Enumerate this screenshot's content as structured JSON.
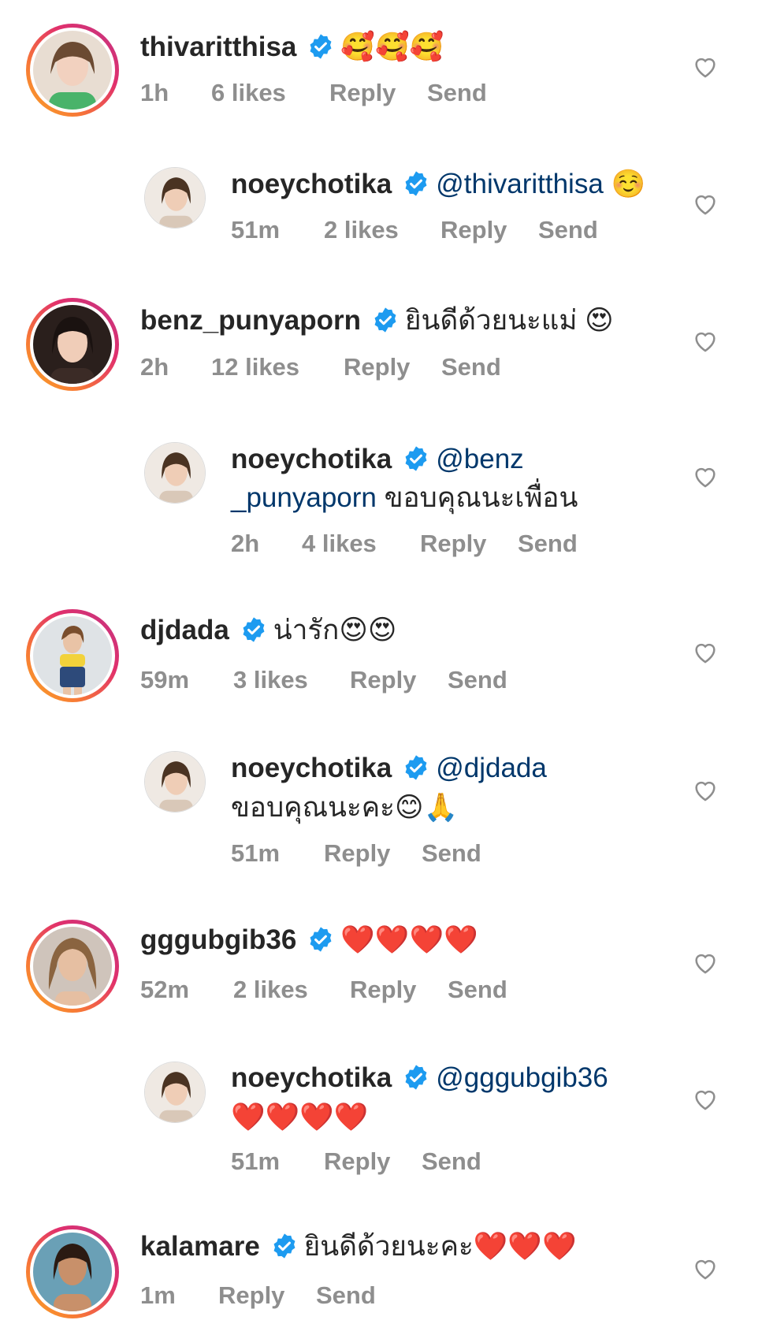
{
  "comments": [
    {
      "username": "thivaritthisa",
      "text": "",
      "emoji": "🥰🥰🥰",
      "time": "1h",
      "likes": "6 likes",
      "reply": "Reply",
      "send": "Send"
    },
    {
      "username": "noeychotika",
      "mention": "@thivaritthisa",
      "text": "",
      "emoji": "☺️",
      "time": "51m",
      "likes": "2 likes",
      "reply": "Reply",
      "send": "Send"
    },
    {
      "username": "benz_punyaporn",
      "text": "ยินดีด้วยนะแม่ ",
      "emoji": "😍",
      "time": "2h",
      "likes": "12 likes",
      "reply": "Reply",
      "send": "Send"
    },
    {
      "username": "noeychotika",
      "mention": "@benz",
      "mention_cont": "_punyaporn",
      "text": " ขอบคุณนะเพื่อน",
      "time": "2h",
      "likes": "4 likes",
      "reply": "Reply",
      "send": "Send"
    },
    {
      "username": "djdada",
      "text": "น่ารัก",
      "emoji": "😍😍",
      "time": "59m",
      "likes": "3 likes",
      "reply": "Reply",
      "send": "Send"
    },
    {
      "username": "noeychotika",
      "mention": "@djdada",
      "text": "ขอบคุณนะคะ",
      "emoji": "😊🙏",
      "time": "51m",
      "reply": "Reply",
      "send": "Send"
    },
    {
      "username": "gggubgib36",
      "text": "",
      "emoji": "❤️❤️❤️❤️",
      "time": "52m",
      "likes": "2 likes",
      "reply": "Reply",
      "send": "Send"
    },
    {
      "username": "noeychotika",
      "mention": "@gggubgib36",
      "text": "",
      "emoji": "❤️❤️❤️❤️",
      "time": "51m",
      "reply": "Reply",
      "send": "Send"
    },
    {
      "username": "kalamare",
      "text": "ยินดีด้วยนะคะ",
      "emoji": "❤️❤️❤️",
      "time": "1m",
      "reply": "Reply",
      "send": "Send"
    }
  ],
  "colors": {
    "text": "#262626",
    "meta": "#8e8e8e",
    "mention": "#00376b",
    "verified": "#1d9bf0"
  },
  "icons": {
    "verified": "verified-badge-icon",
    "like": "heart-outline-icon"
  }
}
